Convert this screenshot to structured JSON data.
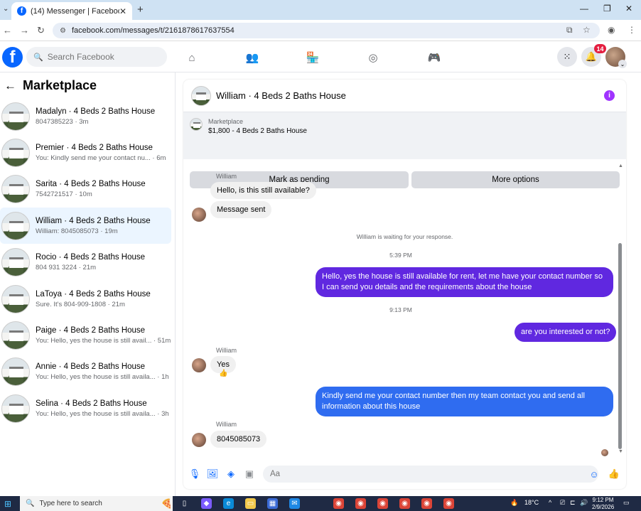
{
  "browser": {
    "tab_title": "(14) Messenger | Facebook",
    "url": "facebook.com/messages/t/2161878617637554"
  },
  "header": {
    "search_placeholder": "Search Facebook",
    "notification_count": "14"
  },
  "sidebar": {
    "title": "Marketplace",
    "conversations": [
      {
        "name": "Madalyn · 4 Beds 2 Baths House",
        "preview": "8047385223 · 3m",
        "active": false
      },
      {
        "name": "Premier · 4 Beds 2 Baths House",
        "preview": "You: Kindly send me your contact nu... · 6m",
        "active": false
      },
      {
        "name": "Sarita · 4 Beds 2 Baths House",
        "preview": "7542721517 · 10m",
        "active": false
      },
      {
        "name": "William · 4 Beds 2 Baths House",
        "preview": "William: 8045085073 · 19m",
        "active": true
      },
      {
        "name": "Rocio · 4 Beds 2 Baths House",
        "preview": "804 931 3224 · 21m",
        "active": false
      },
      {
        "name": "LaToya · 4 Beds 2 Baths House",
        "preview": "Sure. It's 804-909-1808 · 21m",
        "active": false
      },
      {
        "name": "Paige · 4 Beds 2 Baths House",
        "preview": "You: Hello, yes the house is still avail... · 51m",
        "active": false
      },
      {
        "name": "Annie · 4 Beds 2 Baths House",
        "preview": "You: Hello, yes the house is still availa... · 1h",
        "active": false
      },
      {
        "name": "Selina · 4 Beds 2 Baths House",
        "preview": "You: Hello, yes the house is still availa... · 3h",
        "active": false
      }
    ]
  },
  "chat": {
    "title": "William · 4 Beds 2 Baths House",
    "marketplace_label": "Marketplace",
    "listing": "$1,800 - 4 Beds 2 Baths House",
    "mark_pending_label": "Mark as pending",
    "more_options_label": "More options",
    "sender_name": "William",
    "msg1": "Hello, is this still available?",
    "msg2": "Message sent",
    "waiting_text": "William is waiting for your response.",
    "time1": "5:39 PM",
    "out1": "Hello, yes the house is still available for rent, let me have your contact number so I can send you details and the requirements about the house",
    "time2": "9:13 PM",
    "out2": "are you interested or not?",
    "msg3": "Yes",
    "out3": "Kindly send me your contact number then my team contact you and send all information about this house",
    "msg4": "8045085073",
    "composer_placeholder": "Aa"
  },
  "taskbar": {
    "search_text": "Type here to search",
    "temperature": "18°C",
    "time": "9:12 PM",
    "date": "2/9/2026"
  },
  "colors": {
    "fb_blue": "#0866ff",
    "outgoing_purple": "#6028e0",
    "outgoing_blue": "#2f6cf0",
    "active_conversation": "#ebf5ff"
  }
}
